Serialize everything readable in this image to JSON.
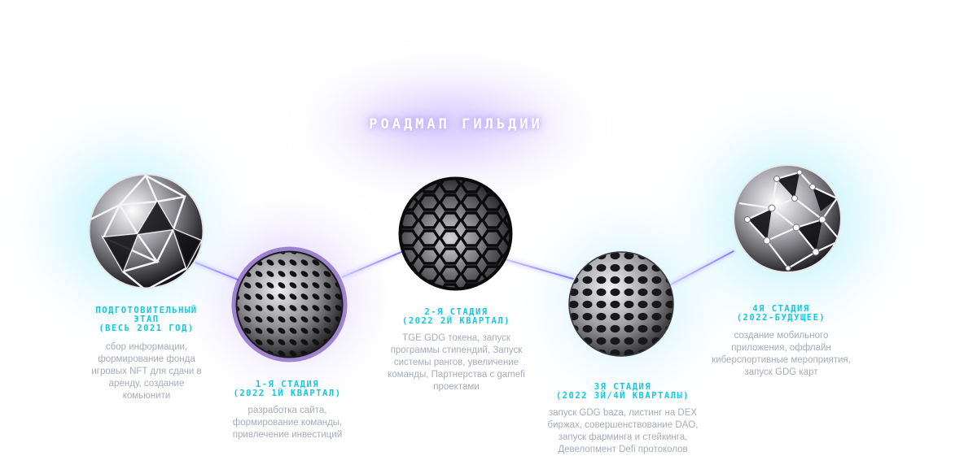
{
  "title": "РОАДМАП ГИЛЬДИИ",
  "stages": [
    {
      "head1": "ПОДГОТОВИТЕЛЬНЫЙ",
      "head2": "ЭТАП",
      "head3": "(ВЕСЬ 2021 ГОД)",
      "desc1": "сбор информации,",
      "desc2": "формирование фонда",
      "desc3": "игровых NFT для сдачи в",
      "desc4": "аренду, создание",
      "desc5": "комьюнити"
    },
    {
      "head1": "1-Я СТАДИЯ",
      "head2": "(2022 1Й КВАРТАЛ)",
      "desc1": "разработка сайта,",
      "desc2": "формирование команды,",
      "desc3": "привлечение инвестиций"
    },
    {
      "head1": "2-Я СТАДИЯ",
      "head2": "(2022 2Й КВАРТАЛ)",
      "desc1": "TGE GDG токена, запуск",
      "desc2": "программы стипендий, Запуск",
      "desc3": "системы рангов, увеличение",
      "desc4": "команды, Партнерства с gamefi",
      "desc5": "проектами"
    },
    {
      "head1": "3Я СТАДИЯ",
      "head2": "(2022 3Й/4Й КВАРТАЛЫ)",
      "desc1": "запуск GDG baza, листинг на DEX",
      "desc2": "биржах, совершенствование  DAO,",
      "desc3": "запуск фарминга и стейкинга,",
      "desc4": "Девелопмент Defi протоколов"
    },
    {
      "head1": "4Я СТАДИЯ",
      "head2": "(2022-БУДУЩЕЕ)",
      "desc1": "создание мобильного",
      "desc2": "приложения, оффлайн",
      "desc3": "киберспортивные мероприятия,",
      "desc4": "запуск GDG карт"
    }
  ]
}
